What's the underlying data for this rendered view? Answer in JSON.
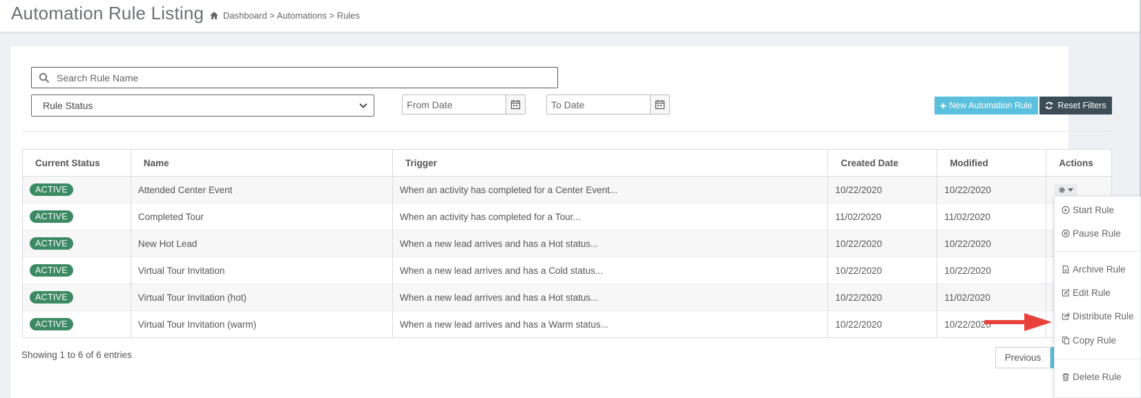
{
  "header": {
    "title": "Automation Rule Listing",
    "breadcrumb": "Dashboard > Automations > Rules"
  },
  "filters": {
    "search_placeholder": "Search Rule Name",
    "rule_status": "Rule Status",
    "from_date_placeholder": "From Date",
    "to_date_placeholder": "To Date",
    "new_rule_label": "New Automation Rule",
    "reset_label": "Reset Filters"
  },
  "table": {
    "headers": [
      "Current Status",
      "Name",
      "Trigger",
      "Created Date",
      "Modified",
      "Actions"
    ],
    "rows": [
      {
        "status": "ACTIVE",
        "name": "Attended Center Event",
        "trigger": "When an activity has completed for a Center Event...",
        "created": "10/22/2020",
        "modified": "10/22/2020"
      },
      {
        "status": "ACTIVE",
        "name": "Completed Tour",
        "trigger": "When an activity has completed for a Tour...",
        "created": "11/02/2020",
        "modified": "11/02/2020"
      },
      {
        "status": "ACTIVE",
        "name": "New Hot Lead",
        "trigger": "When a new lead arrives and has a Hot status...",
        "created": "10/22/2020",
        "modified": "10/22/2020"
      },
      {
        "status": "ACTIVE",
        "name": "Virtual Tour Invitation",
        "trigger": "When a new lead arrives and has a Cold status...",
        "created": "10/22/2020",
        "modified": "10/22/2020"
      },
      {
        "status": "ACTIVE",
        "name": "Virtual Tour Invitation (hot)",
        "trigger": "When a new lead arrives and has a Hot status...",
        "created": "10/22/2020",
        "modified": "11/02/2020"
      },
      {
        "status": "ACTIVE",
        "name": "Virtual Tour Invitation (warm)",
        "trigger": "When a new lead arrives and has a Warm status...",
        "created": "10/22/2020",
        "modified": "10/22/2020"
      }
    ]
  },
  "footer": {
    "showing": "Showing 1 to 6 of 6 entries",
    "previous": "Previous"
  },
  "action_menu": {
    "start": "Start Rule",
    "pause": "Pause Rule",
    "archive": "Archive Rule",
    "edit": "Edit Rule",
    "distribute": "Distribute Rule",
    "copy": "Copy Rule",
    "delete": "Delete Rule"
  },
  "colors": {
    "info_button": "#5bc0de",
    "dark_button": "#3d4d57",
    "active_badge": "#3b8a63",
    "annotation_arrow": "#e8413b"
  }
}
